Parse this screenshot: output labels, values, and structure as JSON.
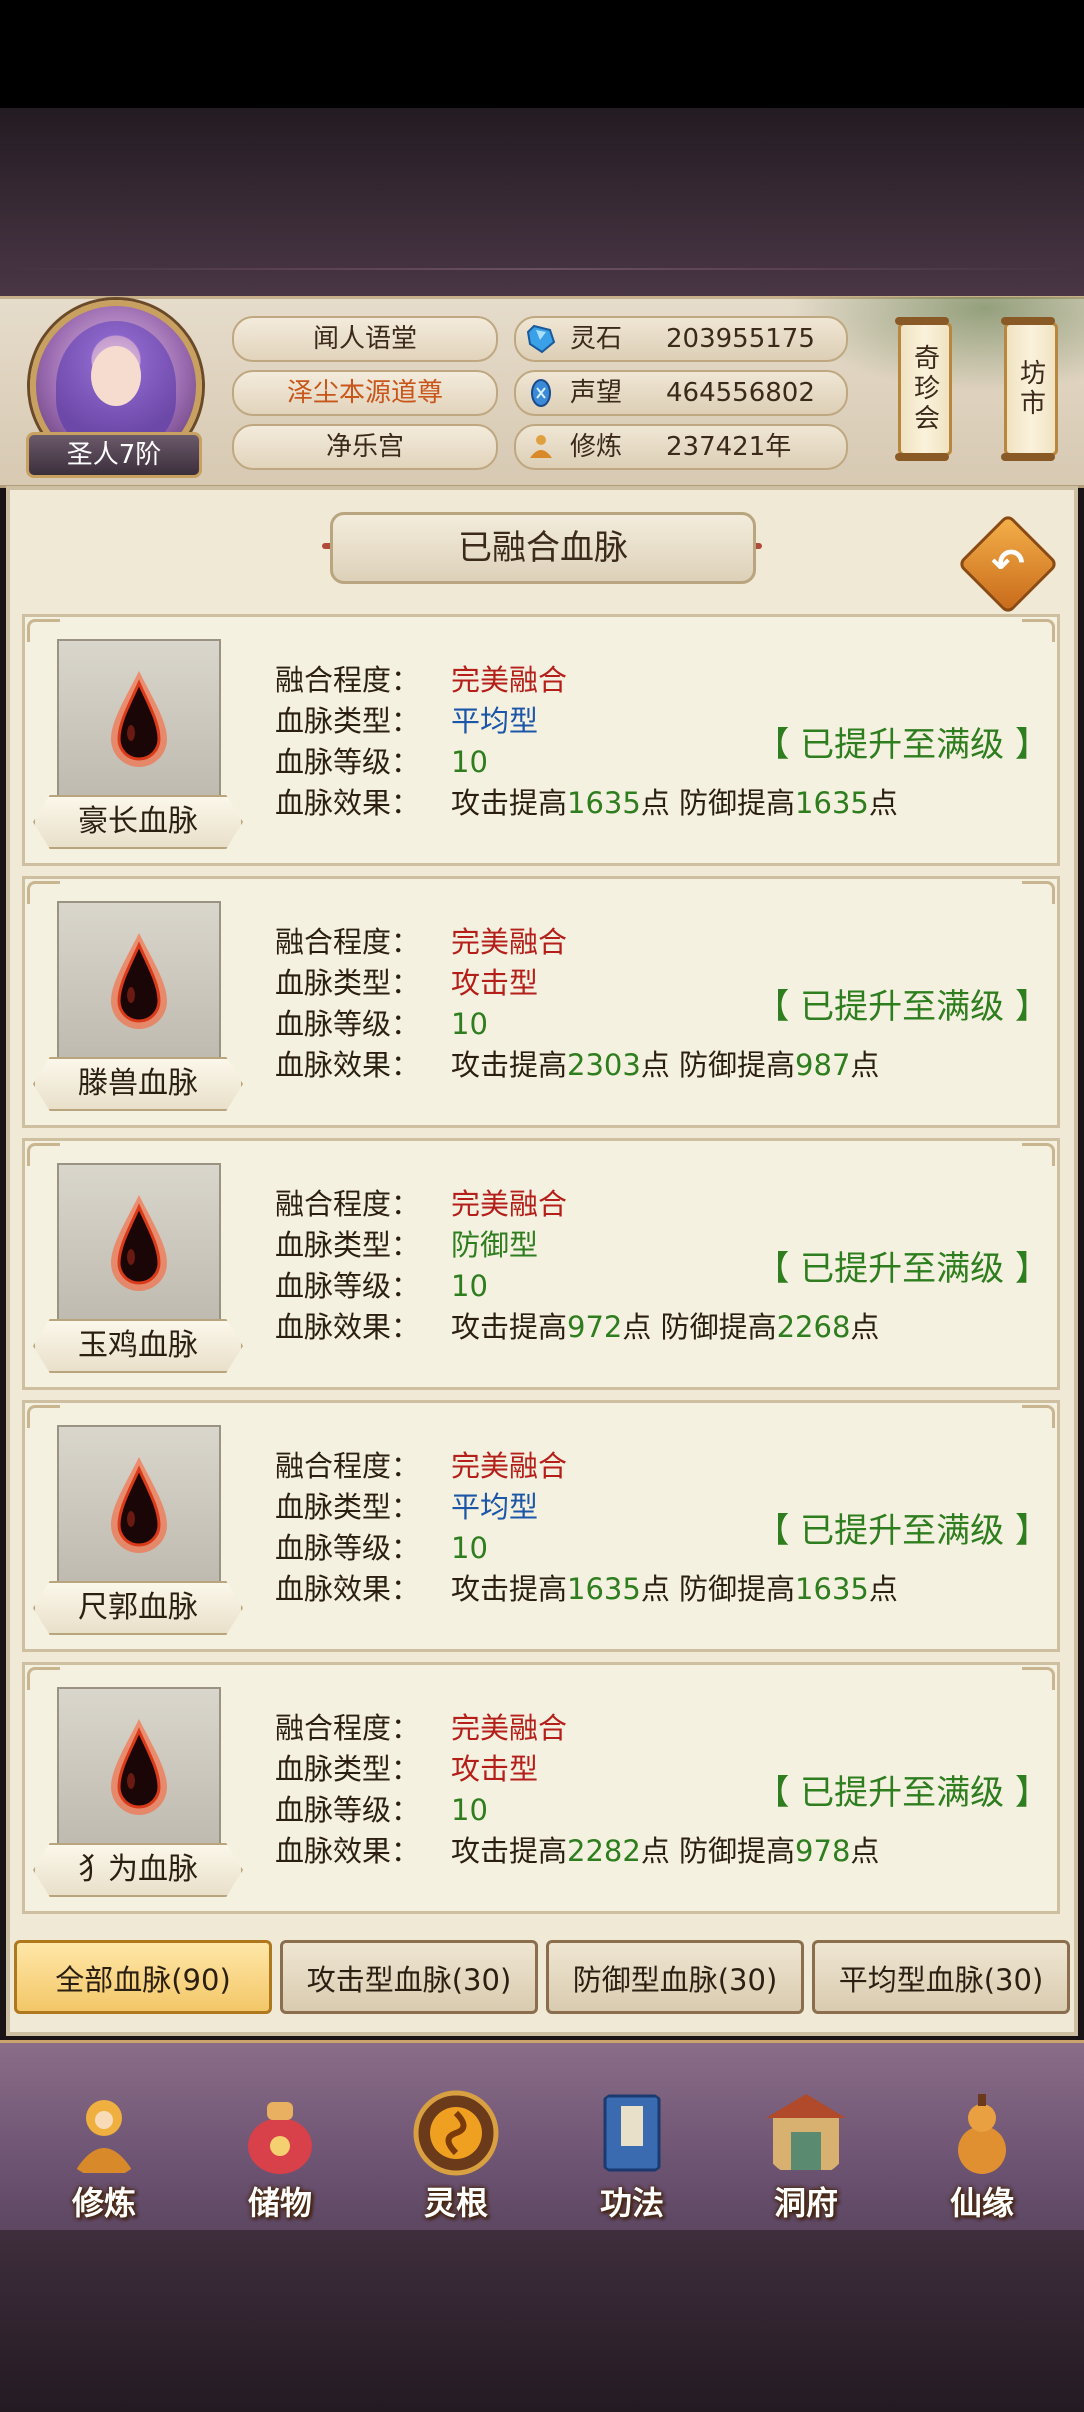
{
  "player": {
    "rank": "圣人7阶",
    "names": [
      "闻人语堂",
      "泽尘本源道尊",
      "净乐宫"
    ]
  },
  "resources": [
    {
      "icon": "spirit-stone-icon",
      "label": "灵石",
      "value": "203955175"
    },
    {
      "icon": "prestige-icon",
      "label": "声望",
      "value": "464556802"
    },
    {
      "icon": "cultivation-icon",
      "label": "修炼",
      "value": "237421年"
    }
  ],
  "shortcuts": {
    "treasure_fair": "奇珍会",
    "market": "坊市"
  },
  "panel": {
    "title": "已融合血脉"
  },
  "field_labels": {
    "fusion": "融合程度：",
    "type": "血脉类型：",
    "level": "血脉等级：",
    "effect": "血脉效果："
  },
  "bloodlines": [
    {
      "name": "豪长血脉",
      "fusion": "完美融合",
      "type": "平均型",
      "type_color": "#1c56a8",
      "level": "10",
      "eff_a": "攻击提高",
      "atk": "1635",
      "eff_b": "点 防御提高",
      "def": "1635",
      "eff_c": "点",
      "status": "【 已提升至满级 】"
    },
    {
      "name": "滕兽血脉",
      "fusion": "完美融合",
      "type": "攻击型",
      "type_color": "#b51f1a",
      "level": "10",
      "eff_a": "攻击提高",
      "atk": "2303",
      "eff_b": "点 防御提高",
      "def": "987",
      "eff_c": "点",
      "status": "【 已提升至满级 】"
    },
    {
      "name": "玉鸡血脉",
      "fusion": "完美融合",
      "type": "防御型",
      "type_color": "#2e7d1e",
      "level": "10",
      "eff_a": "攻击提高",
      "atk": "972",
      "eff_b": "点 防御提高",
      "def": "2268",
      "eff_c": "点",
      "status": "【 已提升至满级 】"
    },
    {
      "name": "尺郭血脉",
      "fusion": "完美融合",
      "type": "平均型",
      "type_color": "#1c56a8",
      "level": "10",
      "eff_a": "攻击提高",
      "atk": "1635",
      "eff_b": "点 防御提高",
      "def": "1635",
      "eff_c": "点",
      "status": "【 已提升至满级 】"
    },
    {
      "name": "犭为血脉",
      "fusion": "完美融合",
      "type": "攻击型",
      "type_color": "#b51f1a",
      "level": "10",
      "eff_a": "攻击提高",
      "atk": "2282",
      "eff_b": "点 防御提高",
      "def": "978",
      "eff_c": "点",
      "status": "【 已提升至满级 】"
    }
  ],
  "filter_tabs": [
    "全部血脉(90)",
    "攻击型血脉(30)",
    "防御型血脉(30)",
    "平均型血脉(30)"
  ],
  "bottom_nav": [
    {
      "icon": "cultivate-icon",
      "label": "修炼"
    },
    {
      "icon": "storage-bag-icon",
      "label": "储物"
    },
    {
      "icon": "spirit-root-icon",
      "label": "灵根"
    },
    {
      "icon": "technique-book-icon",
      "label": "功法"
    },
    {
      "icon": "cave-mansion-icon",
      "label": "洞府"
    },
    {
      "icon": "gourd-icon",
      "label": "仙缘"
    }
  ]
}
